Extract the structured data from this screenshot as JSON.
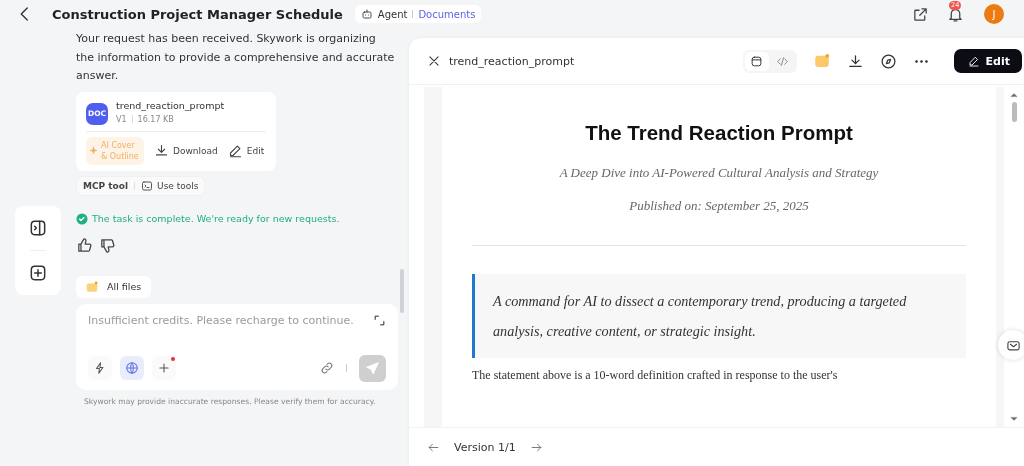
{
  "header": {
    "title": "Construction Project Manager Schedule",
    "mode_labels": [
      {
        "label": "Agent",
        "selected": false
      },
      {
        "label": "Documents",
        "selected": true
      }
    ],
    "notification_count": "24",
    "avatar_initial": "J"
  },
  "chat": {
    "message": "Your request has been received. Skywork is organizing the information to provide a comprehensive and accurate answer.",
    "file_card": {
      "icon_label": "DOC",
      "name": "trend_reaction_prompt",
      "version": "V1",
      "size": "16.17 KB",
      "actions": [
        {
          "kind": "ai",
          "label": "AI Cover & Outline"
        },
        {
          "kind": "download",
          "label": "Download"
        },
        {
          "kind": "edit",
          "label": "Edit"
        }
      ]
    },
    "tool_tag": {
      "label": "MCP tool",
      "action": "Use tools"
    },
    "status": "The task is complete. We're ready for new requests.",
    "all_files": "All files",
    "input": {
      "placeholder": "Insufficient credits. Please recharge to continue.",
      "tools": [
        {
          "kind": "spark",
          "selected": false
        },
        {
          "kind": "globe",
          "selected": true
        },
        {
          "kind": "plus",
          "selected": false
        }
      ]
    },
    "disclaimer": "Skywork may provide inaccurate responses. Please verify them for accuracy."
  },
  "panel": {
    "title": "trend_reaction_prompt",
    "views": [
      {
        "kind": "preview",
        "selected": true
      },
      {
        "kind": "code",
        "selected": false
      }
    ],
    "edit_button": "Edit",
    "document": {
      "title": "The Trend Reaction Prompt",
      "subtitle": "A Deep Dive into AI-Powered Cultural Analysis and Strategy",
      "published": "Published on: September 25, 2025",
      "quote": "A command for AI to dissect a contemporary trend, producing a targeted analysis, creative content, or strategic insight.",
      "paragraph": "The statement above is a 10-word definition crafted in response to the user's"
    },
    "version": "Version 1/1"
  }
}
